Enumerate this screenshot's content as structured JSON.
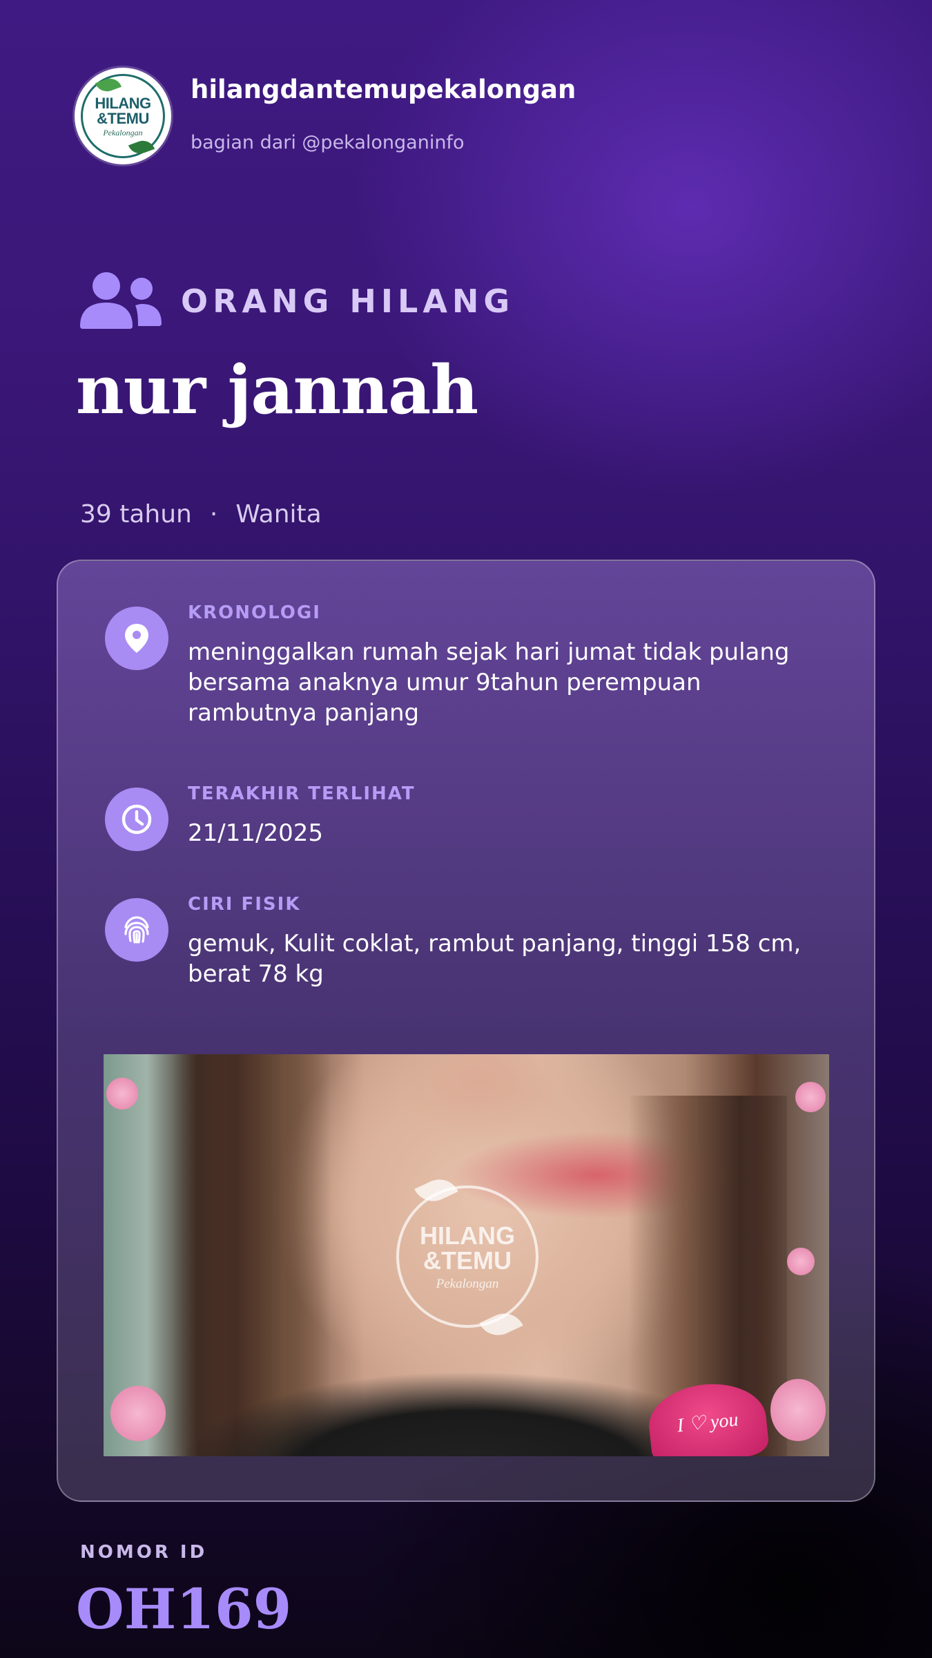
{
  "header": {
    "logo": {
      "line1": "HILANG",
      "line2": "&TEMU",
      "line3": "Pekalongan"
    },
    "account_name": "hilangdantemupekalongan",
    "account_sub": "bagian dari @pekalonganinfo"
  },
  "category": {
    "icon": "users-icon",
    "label": "ORANG HILANG"
  },
  "person": {
    "name": "nur jannah",
    "age": "39 tahun",
    "separator": "·",
    "gender": "Wanita"
  },
  "details": [
    {
      "icon": "location-pin-icon",
      "label": "KRONOLOGI",
      "value": "meninggalkan rumah sejak hari jumat tidak pulang bersama anaknya umur 9tahun perempuan rambutnya panjang"
    },
    {
      "icon": "clock-icon",
      "label": "TERAKHIR TERLIHAT",
      "value": "21/11/2025"
    },
    {
      "icon": "fingerprint-icon",
      "label": "CIRI FISIK",
      "value": "gemuk, Kulit coklat, rambut panjang, tinggi 158 cm, berat 78 kg"
    }
  ],
  "photo": {
    "watermark": {
      "line1": "HILANG",
      "line2": "&TEMU",
      "line3": "Pekalongan"
    },
    "sticker_text": "I ♡ you"
  },
  "footer": {
    "id_label": "NOMOR ID",
    "id_value": "OH169"
  },
  "colors": {
    "accent": "#a78bfa",
    "icon_bg": "#a98bf4",
    "background_top": "#3f1a82",
    "background_bottom": "#0d0618"
  }
}
